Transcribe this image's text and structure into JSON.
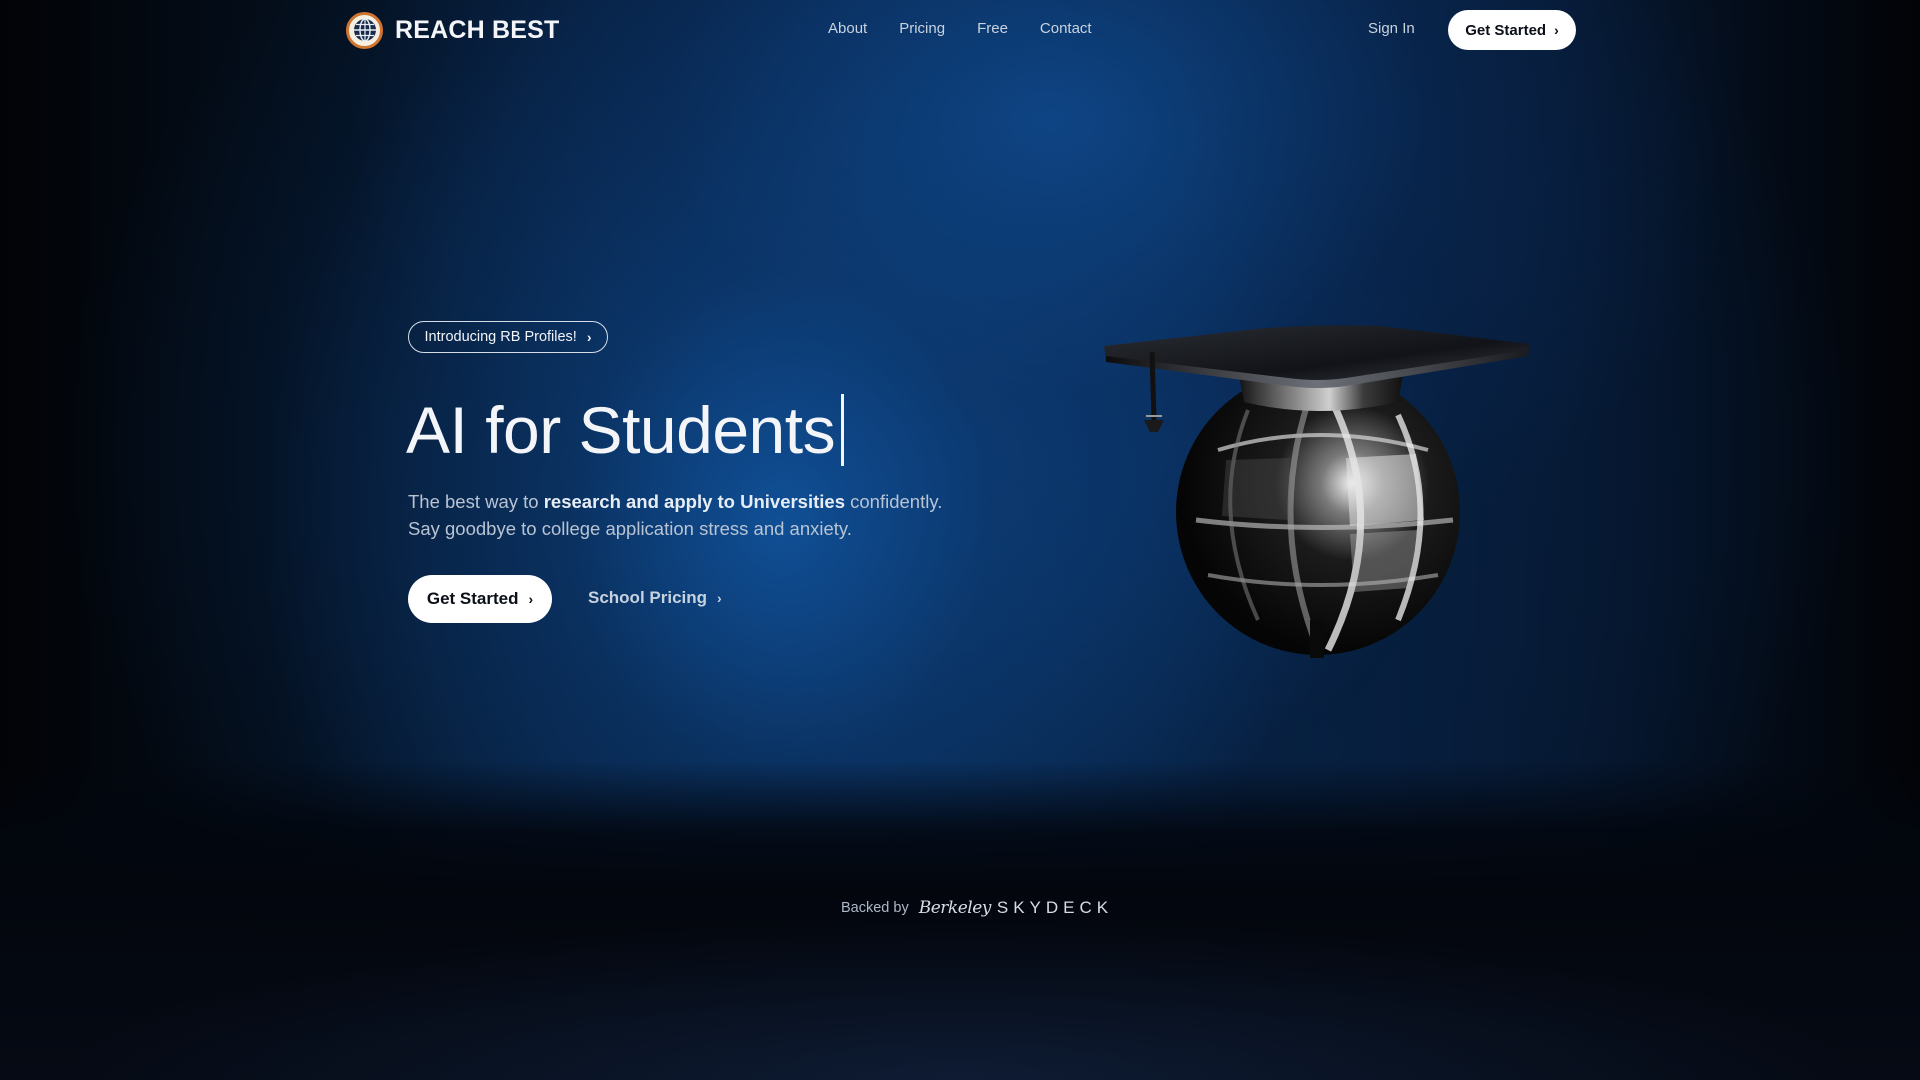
{
  "brand": {
    "name": "REACH BEST",
    "icon": "globe-logo-icon",
    "accent": "#d0742f"
  },
  "nav": {
    "links": [
      "About",
      "Pricing",
      "Free",
      "Contact"
    ],
    "sign_in": "Sign In",
    "cta": "Get Started"
  },
  "hero": {
    "announcement": "Introducing RB Profiles!",
    "headline": "AI for Students",
    "subtitle_part1": "The best way to ",
    "subtitle_bold": "research and apply to Universities",
    "subtitle_part2": " confidently.",
    "subtitle_line2": "Say goodbye to college application stress and anxiety.",
    "primary_cta": "Get Started",
    "secondary_cta": "School Pricing",
    "image": "graduation-cap-globe-3d"
  },
  "footer": {
    "backed_by": "Backed by",
    "backer_script": "Berkeley",
    "backer_caps": "SKYDECK"
  },
  "colors": {
    "background": "#0a2b55",
    "button_bg": "#ffffff",
    "text_muted": "#b8c4d3"
  }
}
